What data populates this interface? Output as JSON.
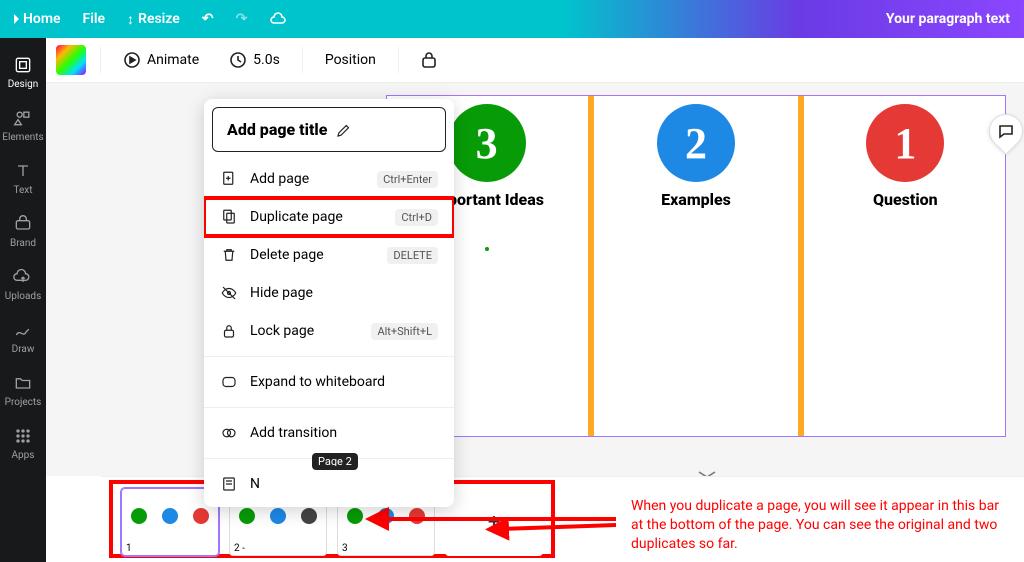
{
  "topbar": {
    "home": "Home",
    "file": "File",
    "resize": "Resize",
    "title": "Your paragraph text"
  },
  "leftrail": {
    "design": "Design",
    "elements": "Elements",
    "text": "Text",
    "brand": "Brand",
    "uploads": "Uploads",
    "draw": "Draw",
    "projects": "Projects",
    "apps": "Apps"
  },
  "toolbar2": {
    "animate": "Animate",
    "duration": "5.0s",
    "position": "Position"
  },
  "menu": {
    "title_placeholder": "Add page title",
    "add_page": "Add page",
    "add_page_kbd": "Ctrl+Enter",
    "duplicate": "Duplicate page",
    "duplicate_kbd": "Ctrl+D",
    "delete": "Delete page",
    "delete_kbd": "DELETE",
    "hide": "Hide page",
    "lock": "Lock page",
    "lock_kbd": "Alt+Shift+L",
    "expand": "Expand to whiteboard",
    "transition": "Add transition",
    "notes_prefix": "N"
  },
  "canvas": {
    "c3": "3",
    "c2": "2",
    "c1": "1",
    "h3": "Important Ideas",
    "h2": "Examples",
    "h1": "Question"
  },
  "thumbs": {
    "tooltip": "Page 2",
    "labels": [
      "1",
      "2 -",
      "3"
    ],
    "add": "+"
  },
  "annotation": "When you duplicate a page, you will see it appear in this bar at the bottom of the page. You can see the original and two duplicates so far.",
  "colors": {
    "accent": "#a076ff",
    "hl": "#ff0000"
  }
}
